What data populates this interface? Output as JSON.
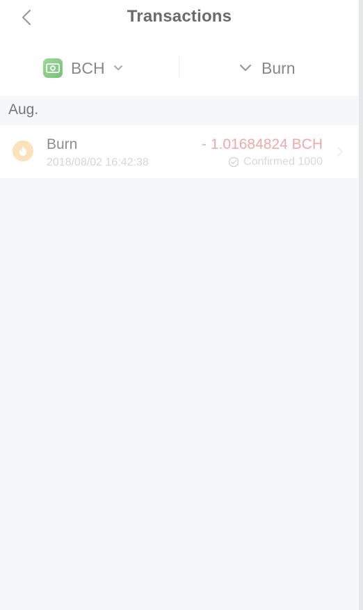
{
  "header": {
    "title": "Transactions",
    "back_icon": "chevron-left-icon"
  },
  "filters": {
    "coin": {
      "label": "BCH",
      "icon": "coin-icon",
      "icon_color": "#7ac77a",
      "dropdown_icon": "chevron-down-icon"
    },
    "type": {
      "label": "Burn",
      "dropdown_icon": "chevron-down-icon"
    }
  },
  "sections": [
    {
      "label": "Aug.",
      "transactions": [
        {
          "type": "Burn",
          "icon": "flame-icon",
          "icon_color": "#f6c27a",
          "datetime": "2018/08/02 16:42:38",
          "amount": "- 1.01684824 BCH",
          "amount_color": "#efa9a9",
          "status": "Confirmed 1000",
          "status_icon": "check-circle-icon"
        }
      ]
    }
  ]
}
